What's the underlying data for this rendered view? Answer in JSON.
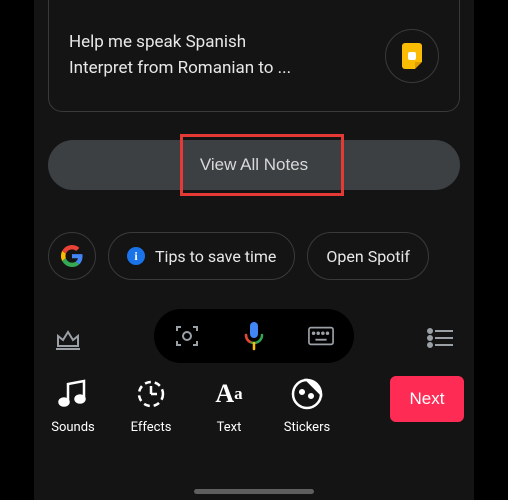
{
  "note": {
    "line1": "Help me speak Spanish",
    "line2": "Interpret from Romanian to ..."
  },
  "view_all_label": "View All Notes",
  "suggestions": {
    "tips_label": "Tips to save time",
    "spotify_label": "Open Spotif"
  },
  "tools": {
    "sounds": "Sounds",
    "effects": "Effects",
    "text": "Text",
    "stickers": "Stickers"
  },
  "next_label": "Next"
}
